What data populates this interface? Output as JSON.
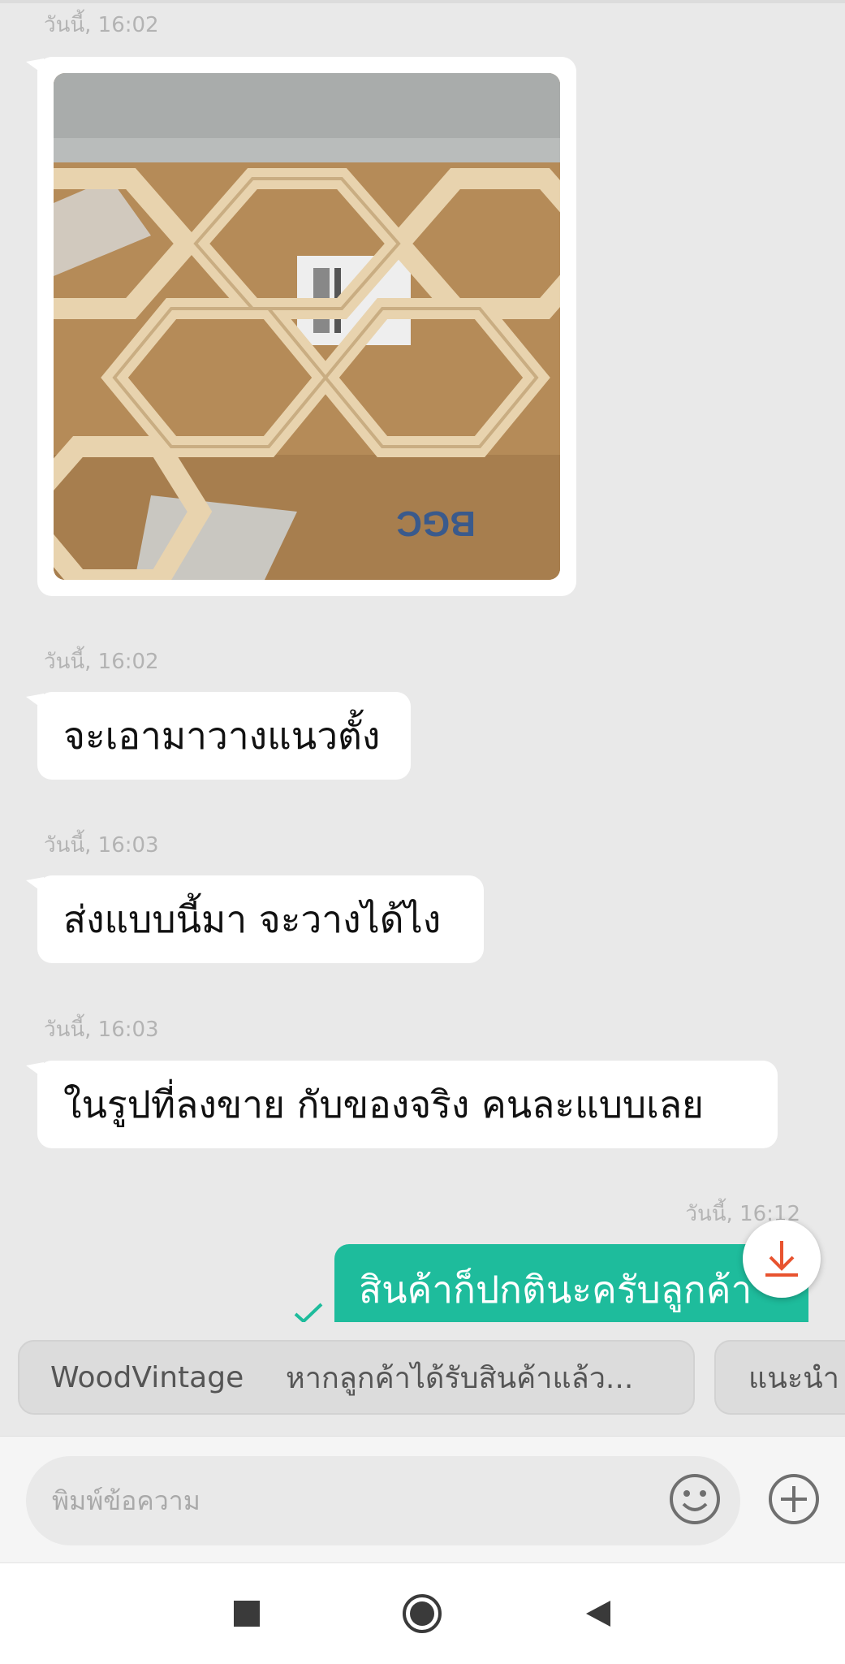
{
  "messages": [
    {
      "timestamp": "วันนี้, 16:02",
      "type": "image",
      "image_desc": "wooden-hexagon-shelf-photo"
    },
    {
      "timestamp": "วันนี้, 16:02",
      "type": "text",
      "text": "จะเอามาวางแนวตั้ง"
    },
    {
      "timestamp": "วันนี้, 16:03",
      "type": "text",
      "text": "ส่งแบบนี้มา จะวางได้ไง"
    },
    {
      "timestamp": "วันนี้, 16:03",
      "type": "text",
      "text": "ในรูปที่ลงขาย กับของจริง คนละแบบเลย"
    },
    {
      "timestamp": "วันนี้, 16:12",
      "type": "text",
      "text": "สินค้าก็ปกตินะครับลูกค้า",
      "outgoing": true
    }
  ],
  "quick_replies": [
    {
      "label": "WoodVintage",
      "preview": "หากลูกค้าได้รับสินค้าแล้ว..."
    },
    {
      "label": "แนะนำ",
      "preview": ""
    }
  ],
  "input": {
    "placeholder": "พิมพ์ข้อความ"
  },
  "colors": {
    "outgoing_bubble": "#1ebc9c",
    "background": "#e9e9e9",
    "download_accent": "#e8532f"
  },
  "icons": {
    "scroll_down": "download-arrow-icon",
    "emoji": "smiley-icon",
    "attach": "plus-circle-icon",
    "nav": [
      "square-icon",
      "circle-icon",
      "back-triangle-icon"
    ]
  }
}
